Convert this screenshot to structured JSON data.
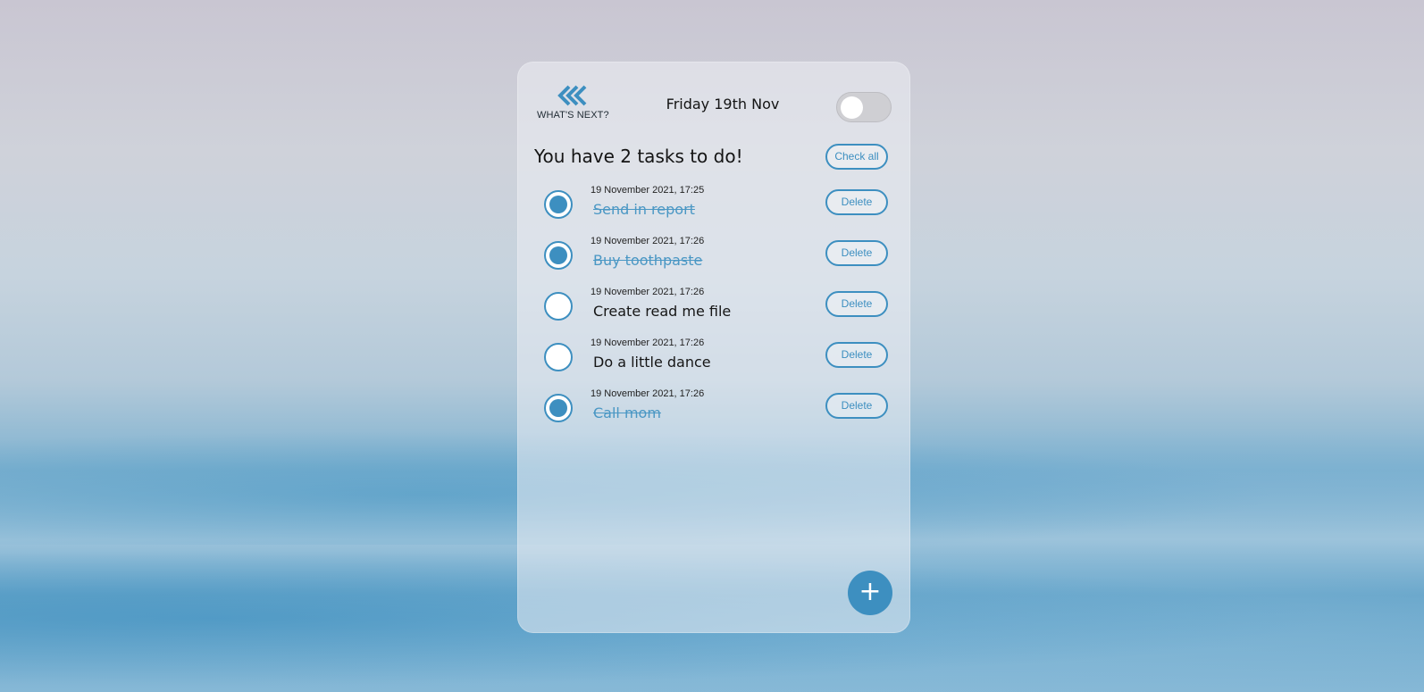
{
  "header": {
    "logo_text": "WHAT'S NEXT?",
    "date": "Friday 19th Nov",
    "dark_mode_toggle": false
  },
  "summary": {
    "headline": "You have 2 tasks to do!",
    "check_all_label": "Check all"
  },
  "tasks": [
    {
      "timestamp": "19 November 2021, 17:25",
      "title": "Send in report",
      "done": true,
      "delete_label": "Delete"
    },
    {
      "timestamp": "19 November 2021, 17:26",
      "title": "Buy toothpaste",
      "done": true,
      "delete_label": "Delete"
    },
    {
      "timestamp": "19 November 2021, 17:26",
      "title": "Create read me file",
      "done": false,
      "delete_label": "Delete"
    },
    {
      "timestamp": "19 November 2021, 17:26",
      "title": "Do a little dance",
      "done": false,
      "delete_label": "Delete"
    },
    {
      "timestamp": "19 November 2021, 17:26",
      "title": "Call mom",
      "done": true,
      "delete_label": "Delete"
    }
  ],
  "add_button_label": "+",
  "colors": {
    "accent": "#3d8fc0",
    "done_text": "#4a97c4"
  },
  "icons": {
    "logo": "double-chevron-left-icon",
    "add": "plus-icon"
  }
}
